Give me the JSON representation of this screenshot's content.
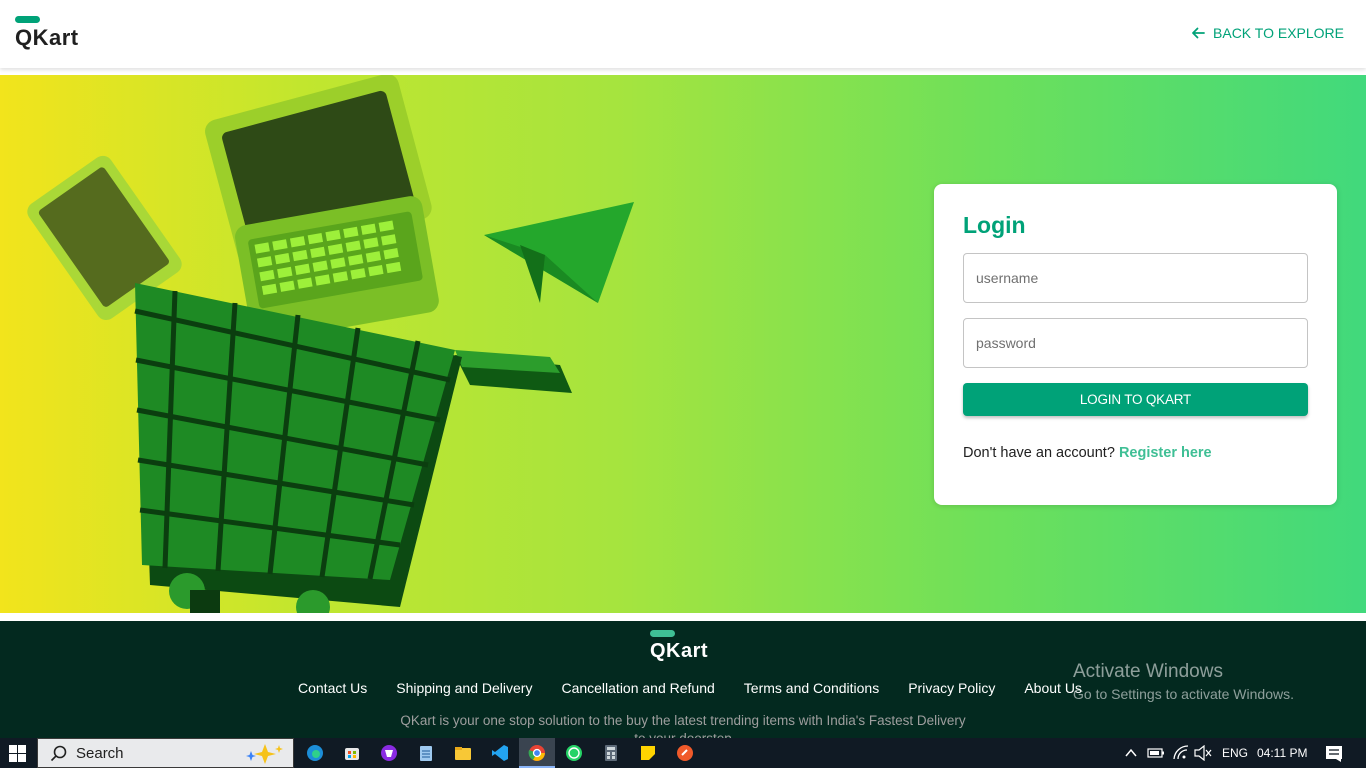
{
  "header": {
    "logo_text": "QKart",
    "back_label": "BACK TO EXPLORE"
  },
  "login": {
    "title": "Login",
    "username_placeholder": "username",
    "password_placeholder": "password",
    "submit_label": "LOGIN TO QKART",
    "signup_prompt": "Don't have an account?",
    "signup_link": "Register here"
  },
  "footer": {
    "logo_text": "QKart",
    "links": [
      "Contact Us",
      "Shipping and Delivery",
      "Cancellation and Refund",
      "Terms and Conditions",
      "Privacy Policy",
      "About Us"
    ],
    "description": "QKart is your one stop solution to the buy the latest trending items with India's Fastest Delivery to your doorstep"
  },
  "watermark": {
    "line1": "Activate Windows",
    "line2": "Go to Settings to activate Windows."
  },
  "taskbar": {
    "search_label": "Search",
    "language": "ENG",
    "time": "04:11 PM",
    "icons": [
      "windows-start-icon",
      "search-icon",
      "edge-icon",
      "store-icon",
      "brave-icon",
      "notepad-icon",
      "file-explorer-icon",
      "vscode-icon",
      "chrome-icon",
      "whatsapp-icon",
      "calculator-icon",
      "sticky-notes-icon",
      "app-icon",
      "chevron-up-icon",
      "battery-icon",
      "wifi-icon",
      "speaker-muted-icon",
      "notification-icon"
    ]
  },
  "colors": {
    "brand": "#00a278",
    "footer_bg": "#03291f",
    "link": "#3fbf95"
  }
}
